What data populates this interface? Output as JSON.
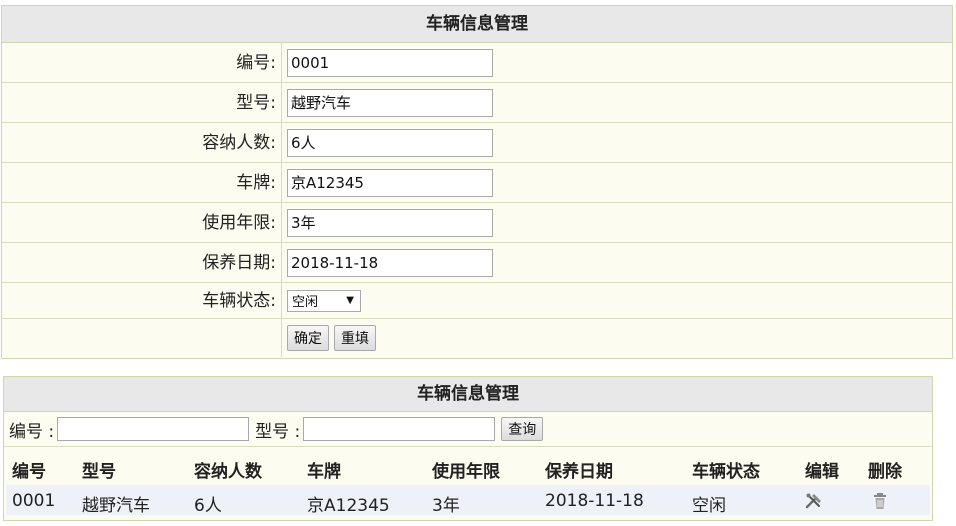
{
  "form": {
    "title": "车辆信息管理",
    "fields": [
      {
        "label": "编号:",
        "value": "0001"
      },
      {
        "label": "型号:",
        "value": "越野汽车"
      },
      {
        "label": "容纳人数:",
        "value": "6人"
      },
      {
        "label": "车牌:",
        "value": "京A12345"
      },
      {
        "label": "使用年限:",
        "value": "3年"
      },
      {
        "label": "保养日期:",
        "value": "2018-11-18"
      }
    ],
    "status_label": "车辆状态:",
    "status_value": "空闲",
    "confirm_label": "确定",
    "reset_label": "重填"
  },
  "list": {
    "title": "车辆信息管理",
    "search_number_label": "编号 :",
    "search_model_label": "型号 :",
    "query_label": "查询",
    "columns": [
      "编号",
      "型号",
      "容纳人数",
      "车牌",
      "使用年限",
      "保养日期",
      "车辆状态",
      "编辑",
      "删除"
    ],
    "rows": [
      [
        "0001",
        "越野汽车",
        "6人",
        "京A12345",
        "3年",
        "2018-11-18",
        "空闲"
      ]
    ]
  }
}
